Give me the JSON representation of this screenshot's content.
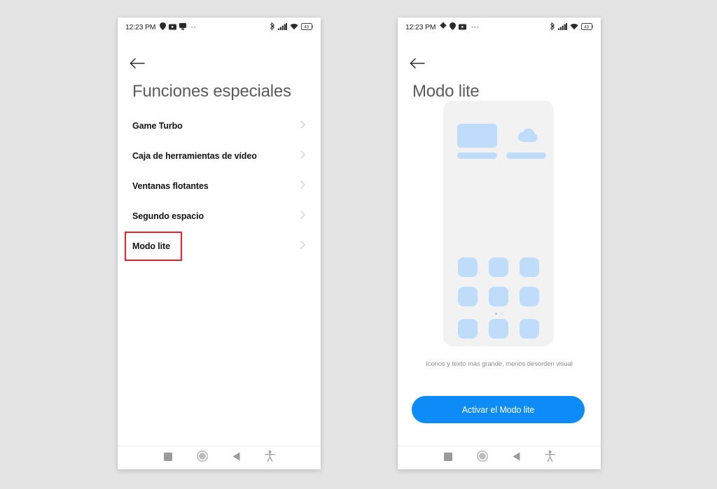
{
  "theme": {
    "page_background": "#e4e4e4",
    "phone_background": "#ffffff",
    "accent_blue": "#0d8bf6",
    "illustration_blue": "#bfdcfa",
    "illustration_panel": "#f2f2f2",
    "highlight_red": "#ec2027",
    "title_gray": "#5b5b5b",
    "caption_gray": "#8e8e8e"
  },
  "phone_left": {
    "status_bar": {
      "time": "12:23 PM",
      "left_icons": [
        "location-pin-icon",
        "video-player-icon",
        "cast-monitor-icon"
      ],
      "overflow": "··",
      "right_icons": [
        "bluetooth-icon",
        "cellular-signal-icon",
        "wifi-icon",
        "battery-icon"
      ],
      "battery_level": "43"
    },
    "back_icon": "back-arrow-icon",
    "title": "Funciones especiales",
    "list": [
      {
        "label": "Game Turbo",
        "chevron": "chevron-right-icon",
        "highlighted": false
      },
      {
        "label": "Caja de herramientas de vídeo",
        "chevron": "chevron-right-icon",
        "highlighted": false
      },
      {
        "label": "Ventanas flotantes",
        "chevron": "chevron-right-icon",
        "highlighted": false
      },
      {
        "label": "Segundo espacio",
        "chevron": "chevron-right-icon",
        "highlighted": false
      },
      {
        "label": "Modo lite",
        "chevron": "chevron-right-icon",
        "highlighted": true
      }
    ],
    "nav_bar": [
      "recents-square-icon",
      "home-circle-icon",
      "back-triangle-icon",
      "accessibility-icon"
    ]
  },
  "phone_right": {
    "status_bar": {
      "time": "12:23 PM",
      "left_icons": [
        "puzzle-icon",
        "location-pin-icon",
        "video-player-icon"
      ],
      "overflow": "···",
      "right_icons": [
        "bluetooth-icon",
        "cellular-signal-icon",
        "wifi-icon",
        "battery-icon"
      ],
      "battery_level": "43"
    },
    "back_icon": "back-arrow-icon",
    "title": "Modo lite",
    "illustration": {
      "widget_card": "widget-card-shape",
      "widget_bar_left": "widget-bar-shape",
      "widget_bar_right": "widget-bar-shape",
      "weather_icon": "cloud-icon",
      "app_icon_count_top": 6,
      "app_icon_count_bottom": 3,
      "page_dots": [
        "active",
        "inactive"
      ]
    },
    "caption": "Iconos y texto más grande, menos desorden visual",
    "cta_label": "Activar el Modo lite",
    "nav_bar": [
      "recents-square-icon",
      "home-circle-icon",
      "back-triangle-icon",
      "accessibility-icon"
    ]
  }
}
